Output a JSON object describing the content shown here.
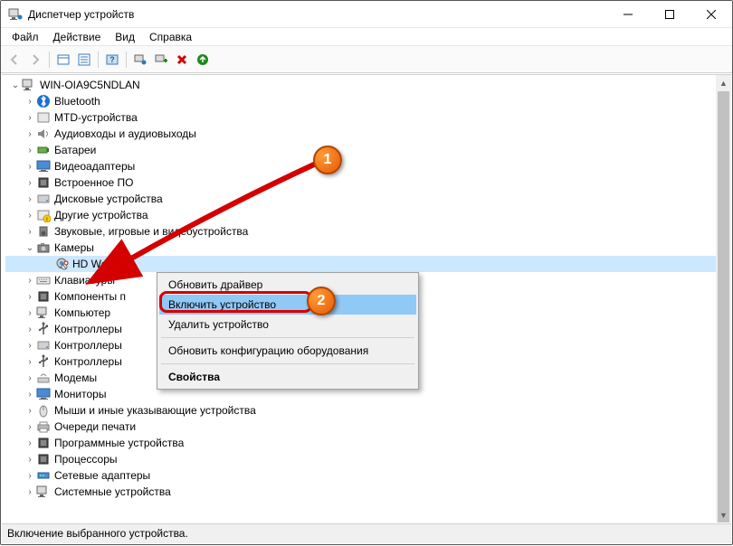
{
  "window": {
    "title": "Диспетчер устройств"
  },
  "menu": {
    "file": "Файл",
    "action": "Действие",
    "view": "Вид",
    "help": "Справка"
  },
  "tree": {
    "root": "WIN-OIA9C5NDLAN",
    "items": [
      "Bluetooth",
      "MTD-устройства",
      "Аудиовходы и аудиовыходы",
      "Батареи",
      "Видеоадаптеры",
      "Встроенное ПО",
      "Дисковые устройства",
      "Другие устройства",
      "Звуковые, игровые и видеоустройства"
    ],
    "cameras_label": "Камеры",
    "camera_child": "HD WebCa",
    "items2": [
      "Клавиатуры",
      "Компоненты п",
      "Компьютер",
      "Контроллеры",
      "Контроллеры",
      "Контроллеры",
      "Модемы",
      "Мониторы",
      "Мыши и иные указывающие устройства",
      "Очереди печати",
      "Программные устройства",
      "Процессоры",
      "Сетевые адаптеры",
      "Системные устройства"
    ]
  },
  "context_menu": {
    "update_driver": "Обновить драйвер",
    "enable_device": "Включить устройство",
    "remove_device": "Удалить устройство",
    "refresh_config": "Обновить конфигурацию оборудования",
    "properties": "Свойства"
  },
  "status": "Включение выбранного устройства.",
  "callouts": {
    "one": "1",
    "two": "2"
  }
}
